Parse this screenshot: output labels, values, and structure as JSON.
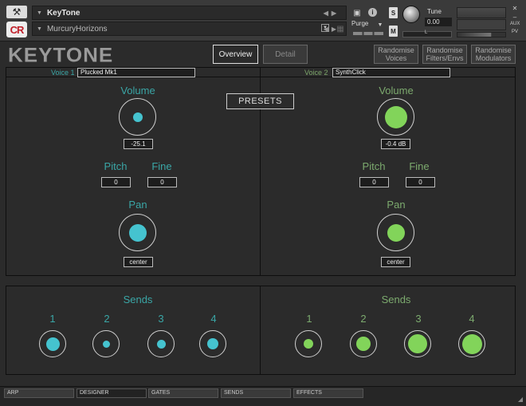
{
  "header": {
    "instrument_name": "KeyTone",
    "preset_name": "MurcuryHorizons",
    "logo_text": "CR",
    "purge_label": "Purge",
    "solo_label": "S",
    "mute_label": "M",
    "tune_label": "Tune",
    "tune_value": "0.00",
    "pan_marker": "L",
    "icons": [
      "wrench-icon",
      "camera-icon",
      "info-icon",
      "chevron-down-icon"
    ]
  },
  "title": {
    "logo": "KEYTONE",
    "tabs": [
      {
        "label": "Overview",
        "active": true
      },
      {
        "label": "Detail",
        "active": false
      }
    ],
    "randomise_buttons": [
      {
        "line1": "Randomise",
        "line2": "Voices"
      },
      {
        "line1": "Randomise",
        "line2": "Filters/Envs"
      },
      {
        "line1": "Randomise",
        "line2": "Modulators"
      }
    ]
  },
  "voice1": {
    "label": "Voice 1",
    "name": "Plucked Mk1",
    "volume_label": "Volume",
    "volume_value": "-25.1",
    "pitch_label": "Pitch",
    "pitch_value": "0",
    "fine_label": "Fine",
    "fine_value": "0",
    "pan_label": "Pan",
    "pan_value": "center",
    "color": "#45c3cf"
  },
  "voice2": {
    "label": "Voice 2",
    "name": "SynthClick",
    "volume_label": "Volume",
    "volume_value": "-0.4 dB",
    "pitch_label": "Pitch",
    "pitch_value": "0",
    "fine_label": "Fine",
    "fine_value": "0",
    "pan_label": "Pan",
    "pan_value": "center",
    "color": "#82d45a"
  },
  "presets_label": "PRESETS",
  "sends": {
    "title": "Sends",
    "voice1": [
      {
        "label": "1",
        "level": 0.55
      },
      {
        "label": "2",
        "level": 0.2
      },
      {
        "label": "3",
        "level": 0.3
      },
      {
        "label": "4",
        "level": 0.45
      }
    ],
    "voice2": [
      {
        "label": "1",
        "level": 0.35
      },
      {
        "label": "2",
        "level": 0.6
      },
      {
        "label": "3",
        "level": 0.9
      },
      {
        "label": "4",
        "level": 0.95
      }
    ]
  },
  "bottom_tabs": [
    {
      "label": "ARP",
      "active": false
    },
    {
      "label": "DESIGNER",
      "active": true
    },
    {
      "label": "GATES",
      "active": false
    },
    {
      "label": "SENDS",
      "active": false
    },
    {
      "label": "EFFECTS",
      "active": false
    }
  ]
}
